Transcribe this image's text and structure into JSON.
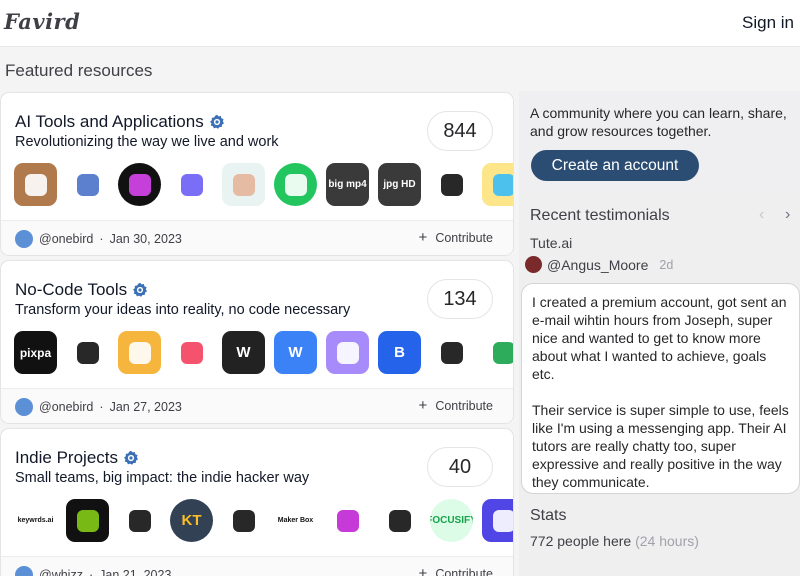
{
  "header": {
    "logo": "Favird",
    "signin": "Sign in"
  },
  "featured_title": "Featured resources",
  "cards": [
    {
      "title": "AI Tools and Applications",
      "subtitle": "Revolutionizing the way we live and work",
      "count": "844",
      "author": "@onebird",
      "date": "Jan 30, 2023",
      "contribute": "Contribute",
      "icons": [
        {
          "name": "portrait-photo-icon",
          "label": "",
          "bg": "#b07a4d",
          "fg": "#ffffff",
          "round": false
        },
        {
          "name": "wave-chart-icon",
          "label": "",
          "bg": "#ffffff",
          "fg": "#4a72c8",
          "round": false
        },
        {
          "name": "paint-brush-icon",
          "label": "",
          "bg": "#111111",
          "fg": "#d946ef",
          "round": true
        },
        {
          "name": "purple-shape-icon",
          "label": "",
          "bg": "#ffffff",
          "fg": "#6d5ef5",
          "round": false
        },
        {
          "name": "face-scan-icon",
          "label": "",
          "bg": "#e9f3f2",
          "fg": "#e6b59b",
          "round": false
        },
        {
          "name": "green-face-icon",
          "label": "",
          "bg": "#22c55e",
          "fg": "#ffffff",
          "round": true
        },
        {
          "name": "big-mp4-icon",
          "label": "big mp4",
          "bg": "#3a3a3a",
          "fg": "#ffffff",
          "round": false
        },
        {
          "name": "jpg-hd-icon",
          "label": "jpg HD",
          "bg": "#3a3a3a",
          "fg": "#ffffff",
          "round": false
        },
        {
          "name": "eraser-icon",
          "label": "",
          "bg": "#ffffff",
          "fg": "#111111",
          "round": false
        },
        {
          "name": "anime-character-icon",
          "label": "",
          "bg": "#fde68a",
          "fg": "#38bdf8",
          "round": false
        }
      ]
    },
    {
      "title": "No-Code Tools",
      "subtitle": "Transform your ideas into reality, no code necessary",
      "count": "134",
      "author": "@onebird",
      "date": "Jan 27, 2023",
      "contribute": "Contribute",
      "icons": [
        {
          "name": "pixpa-icon",
          "label": "pixpa",
          "bg": "#111111",
          "fg": "#ffffff",
          "round": false
        },
        {
          "name": "circles-logo-icon",
          "label": "",
          "bg": "#ffffff",
          "fg": "#111111",
          "round": false
        },
        {
          "name": "lightning-icon",
          "label": "",
          "bg": "#f6b53d",
          "fg": "#ffffff",
          "round": false
        },
        {
          "name": "pinwheel-icon",
          "label": "",
          "bg": "#ffffff",
          "fg": "#f43f5e",
          "round": false
        },
        {
          "name": "webflow-w-icon",
          "label": "W",
          "bg": "#222222",
          "fg": "#ffffff",
          "round": false
        },
        {
          "name": "wix-w-icon",
          "label": "W",
          "bg": "#3b82f6",
          "fg": "#ffffff",
          "round": false
        },
        {
          "name": "app-screens-icon",
          "label": "",
          "bg": "#a78bfa",
          "fg": "#ffffff",
          "round": false
        },
        {
          "name": "bookmark-b-icon",
          "label": "B",
          "bg": "#2563eb",
          "fg": "#ffffff",
          "round": false
        },
        {
          "name": "broken-link-icon",
          "label": "",
          "bg": "#ffffff",
          "fg": "#111111",
          "round": false
        },
        {
          "name": "green-swoosh-icon",
          "label": "",
          "bg": "#ffffff",
          "fg": "#16a34a",
          "round": false
        }
      ]
    },
    {
      "title": "Indie Projects",
      "subtitle": "Small teams, big impact: the indie hacker way",
      "count": "40",
      "author": "@whizz",
      "date": "Jan 21, 2023",
      "contribute": "Contribute",
      "icons": [
        {
          "name": "keywrds-ai-icon",
          "label": "keywrds.ai",
          "bg": "#ffffff",
          "fg": "#111111",
          "round": false
        },
        {
          "name": "green-gear-icon",
          "label": "",
          "bg": "#111111",
          "fg": "#84cc16",
          "round": false
        },
        {
          "name": "mountain-m-icon",
          "label": "",
          "bg": "#ffffff",
          "fg": "#111111",
          "round": false
        },
        {
          "name": "kt-logo-icon",
          "label": "KT",
          "bg": "#334155",
          "fg": "#fbbf24",
          "round": true
        },
        {
          "name": "chess-knight-icon",
          "label": "",
          "bg": "#ffffff",
          "fg": "#111111",
          "round": false
        },
        {
          "name": "maker-box-icon",
          "label": "Maker Box",
          "bg": "#ffffff",
          "fg": "#111111",
          "round": false
        },
        {
          "name": "magenta-blob-icon",
          "label": "",
          "bg": "#ffffff",
          "fg": "#c026d3",
          "round": false
        },
        {
          "name": "bird-bicycle-icon",
          "label": "",
          "bg": "#ffffff",
          "fg": "#111111",
          "round": false
        },
        {
          "name": "focusify-bolt-icon",
          "label": "FOCUSIFY",
          "bg": "#dcfce7",
          "fg": "#16a34a",
          "round": true
        },
        {
          "name": "chain-link-icon",
          "label": "",
          "bg": "#4f46e5",
          "fg": "#ffffff",
          "round": false
        }
      ]
    }
  ],
  "sidebar": {
    "cta_text": "A community where you can learn, share, and grow resources together.",
    "cta_button": "Create an account",
    "testimonials_title": "Recent testimonials",
    "testimonial_source": "Tute.ai",
    "testimonial_user": "@Angus_Moore",
    "testimonial_ago": "2d",
    "testimonial_p1": "I created a premium account, got sent an e-mail wihtin hours from Joseph, super nice and wanted to get to know more about what I wanted to achieve, goals etc.",
    "testimonial_p2": "Their service is super simple to use, feels like I'm using a messenging app. Their AI tutors are really chatty too, super expressive and really positive in the way they communicate.",
    "stats_title": "Stats",
    "stats_people": "772 people here",
    "stats_period": "(24 hours)"
  }
}
